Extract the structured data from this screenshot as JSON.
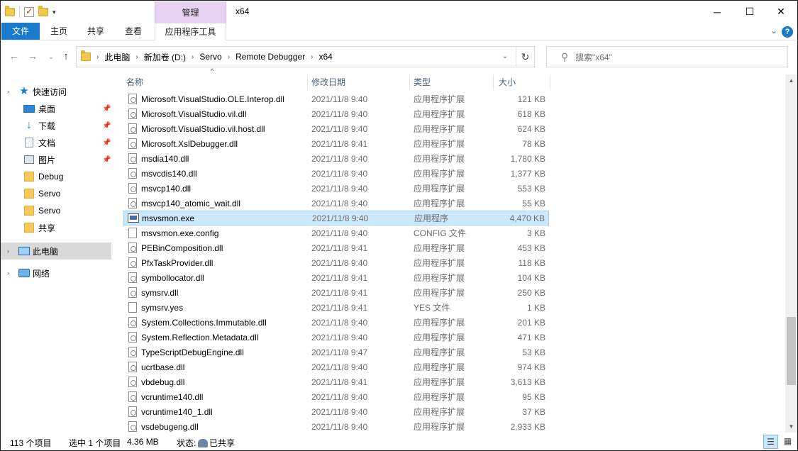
{
  "window": {
    "title": "x64",
    "context_tab": "管理",
    "minimize": "─",
    "maximize": "☐",
    "close": "✕"
  },
  "ribbon": {
    "tabs": [
      "文件",
      "主页",
      "共享",
      "查看",
      "应用程序工具"
    ]
  },
  "address": {
    "crumbs": [
      "此电脑",
      "新加卷 (D:)",
      "Servo",
      "Remote Debugger",
      "x64"
    ]
  },
  "search": {
    "placeholder": "搜索\"x64\""
  },
  "nav": {
    "items": [
      {
        "label": "快速访问",
        "icon": "star-icon"
      },
      {
        "label": "桌面",
        "icon": "desktop-icon",
        "pinned": true
      },
      {
        "label": "下载",
        "icon": "download-icon",
        "pinned": true
      },
      {
        "label": "文档",
        "icon": "document-icon",
        "pinned": true
      },
      {
        "label": "图片",
        "icon": "picture-icon",
        "pinned": true
      },
      {
        "label": "Debug",
        "icon": "folder-icon"
      },
      {
        "label": "Servo",
        "icon": "folder-icon"
      },
      {
        "label": "Servo",
        "icon": "folder-icon"
      },
      {
        "label": "共享",
        "icon": "folder-icon"
      },
      {
        "label": "此电脑",
        "icon": "computer-icon",
        "selected": true
      },
      {
        "label": "网络",
        "icon": "network-icon"
      }
    ]
  },
  "columns": {
    "name": "名称",
    "date": "修改日期",
    "type": "类型",
    "size": "大小"
  },
  "files": [
    {
      "name": "Microsoft.VisualStudio.OLE.Interop.dll",
      "date": "2021/11/8 9:40",
      "type": "应用程序扩展",
      "size": "121 KB",
      "kind": "dll"
    },
    {
      "name": "Microsoft.VisualStudio.vil.dll",
      "date": "2021/11/8 9:40",
      "type": "应用程序扩展",
      "size": "618 KB",
      "kind": "dll"
    },
    {
      "name": "Microsoft.VisualStudio.vil.host.dll",
      "date": "2021/11/8 9:40",
      "type": "应用程序扩展",
      "size": "624 KB",
      "kind": "dll"
    },
    {
      "name": "Microsoft.XslDebugger.dll",
      "date": "2021/11/8 9:41",
      "type": "应用程序扩展",
      "size": "78 KB",
      "kind": "dll"
    },
    {
      "name": "msdia140.dll",
      "date": "2021/11/8 9:40",
      "type": "应用程序扩展",
      "size": "1,780 KB",
      "kind": "dll"
    },
    {
      "name": "msvcdis140.dll",
      "date": "2021/11/8 9:40",
      "type": "应用程序扩展",
      "size": "1,377 KB",
      "kind": "dll"
    },
    {
      "name": "msvcp140.dll",
      "date": "2021/11/8 9:40",
      "type": "应用程序扩展",
      "size": "553 KB",
      "kind": "dll"
    },
    {
      "name": "msvcp140_atomic_wait.dll",
      "date": "2021/11/8 9:40",
      "type": "应用程序扩展",
      "size": "55 KB",
      "kind": "dll"
    },
    {
      "name": "msvsmon.exe",
      "date": "2021/11/8 9:40",
      "type": "应用程序",
      "size": "4,470 KB",
      "kind": "exe",
      "selected": true
    },
    {
      "name": "msvsmon.exe.config",
      "date": "2021/11/8 9:40",
      "type": "CONFIG 文件",
      "size": "3 KB",
      "kind": "file"
    },
    {
      "name": "PEBinComposition.dll",
      "date": "2021/11/8 9:41",
      "type": "应用程序扩展",
      "size": "453 KB",
      "kind": "dll"
    },
    {
      "name": "PfxTaskProvider.dll",
      "date": "2021/11/8 9:40",
      "type": "应用程序扩展",
      "size": "118 KB",
      "kind": "dll"
    },
    {
      "name": "symbollocator.dll",
      "date": "2021/11/8 9:41",
      "type": "应用程序扩展",
      "size": "104 KB",
      "kind": "dll"
    },
    {
      "name": "symsrv.dll",
      "date": "2021/11/8 9:41",
      "type": "应用程序扩展",
      "size": "250 KB",
      "kind": "dll"
    },
    {
      "name": "symsrv.yes",
      "date": "2021/11/8 9:41",
      "type": "YES 文件",
      "size": "1 KB",
      "kind": "file"
    },
    {
      "name": "System.Collections.Immutable.dll",
      "date": "2021/11/8 9:40",
      "type": "应用程序扩展",
      "size": "201 KB",
      "kind": "dll"
    },
    {
      "name": "System.Reflection.Metadata.dll",
      "date": "2021/11/8 9:40",
      "type": "应用程序扩展",
      "size": "471 KB",
      "kind": "dll"
    },
    {
      "name": "TypeScriptDebugEngine.dll",
      "date": "2021/11/8 9:47",
      "type": "应用程序扩展",
      "size": "53 KB",
      "kind": "dll"
    },
    {
      "name": "ucrtbase.dll",
      "date": "2021/11/8 9:40",
      "type": "应用程序扩展",
      "size": "974 KB",
      "kind": "dll"
    },
    {
      "name": "vbdebug.dll",
      "date": "2021/11/8 9:41",
      "type": "应用程序扩展",
      "size": "3,613 KB",
      "kind": "dll"
    },
    {
      "name": "vcruntime140.dll",
      "date": "2021/11/8 9:40",
      "type": "应用程序扩展",
      "size": "95 KB",
      "kind": "dll"
    },
    {
      "name": "vcruntime140_1.dll",
      "date": "2021/11/8 9:40",
      "type": "应用程序扩展",
      "size": "37 KB",
      "kind": "dll"
    },
    {
      "name": "vsdebugeng.dll",
      "date": "2021/11/8 9:40",
      "type": "应用程序扩展",
      "size": "2,933 KB",
      "kind": "dll"
    }
  ],
  "status": {
    "count": "113 个项目",
    "selection": "选中 1 个项目",
    "selection_size": "4.36 MB",
    "state_label": "状态:",
    "state_value": "已共享"
  },
  "colors": {
    "accent": "#1979ca",
    "context_tab": "#e7d1f5",
    "selection": "#cce8ff"
  }
}
